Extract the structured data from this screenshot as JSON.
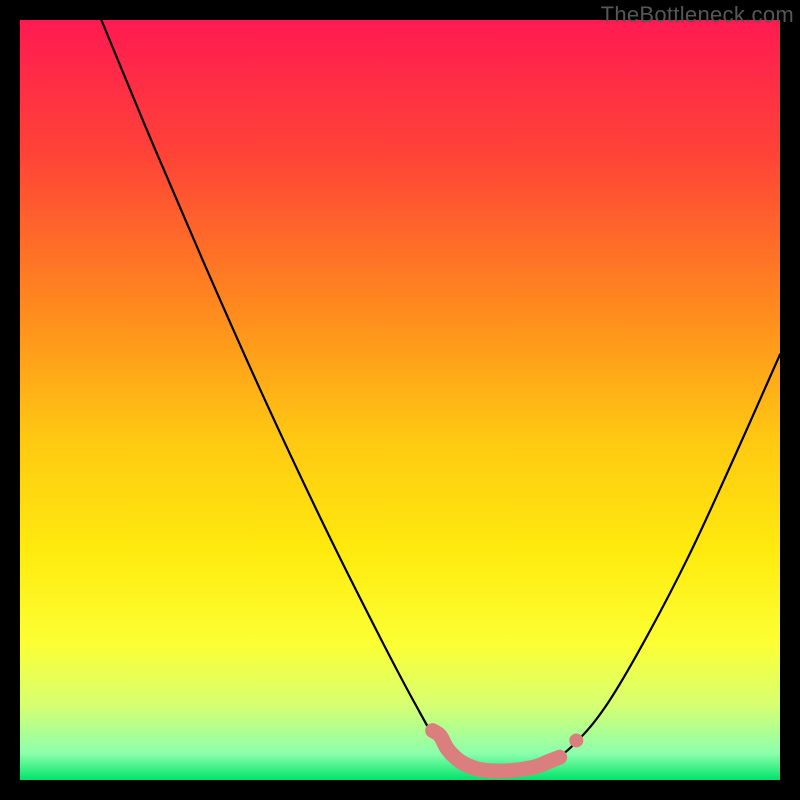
{
  "watermark": "TheBottleneck.com",
  "chart_data": {
    "type": "line",
    "title": "",
    "xlabel": "",
    "ylabel": "",
    "xlim": [
      0,
      100
    ],
    "ylim": [
      0,
      100
    ],
    "grid": false,
    "legend": null,
    "gradient_stops": [
      {
        "offset": 0.0,
        "color": "#ff1a51"
      },
      {
        "offset": 0.18,
        "color": "#ff4437"
      },
      {
        "offset": 0.38,
        "color": "#ff8a1e"
      },
      {
        "offset": 0.55,
        "color": "#ffc812"
      },
      {
        "offset": 0.7,
        "color": "#ffeb0e"
      },
      {
        "offset": 0.82,
        "color": "#fcff34"
      },
      {
        "offset": 0.9,
        "color": "#d8ff70"
      },
      {
        "offset": 0.965,
        "color": "#8cffad"
      },
      {
        "offset": 1.0,
        "color": "#00e46a"
      }
    ],
    "series": [
      {
        "name": "curve",
        "stroke": "#000000",
        "points": [
          {
            "x": 10.7,
            "y": 100.0
          },
          {
            "x": 16.5,
            "y": 86.0
          },
          {
            "x": 24.0,
            "y": 68.5
          },
          {
            "x": 32.0,
            "y": 50.5
          },
          {
            "x": 40.0,
            "y": 33.5
          },
          {
            "x": 47.0,
            "y": 19.5
          },
          {
            "x": 52.0,
            "y": 10.0
          },
          {
            "x": 55.0,
            "y": 5.0
          },
          {
            "x": 58.0,
            "y": 2.2
          },
          {
            "x": 62.0,
            "y": 1.2
          },
          {
            "x": 66.0,
            "y": 1.4
          },
          {
            "x": 70.0,
            "y": 2.6
          },
          {
            "x": 73.0,
            "y": 4.8
          },
          {
            "x": 77.0,
            "y": 9.6
          },
          {
            "x": 82.0,
            "y": 18.0
          },
          {
            "x": 88.0,
            "y": 29.5
          },
          {
            "x": 94.0,
            "y": 42.5
          },
          {
            "x": 100.0,
            "y": 56.0
          }
        ]
      },
      {
        "name": "marker-band",
        "stroke": "#da7e7e",
        "points": [
          {
            "x": 54.3,
            "y": 6.5
          },
          {
            "x": 55.3,
            "y": 5.8
          },
          {
            "x": 56.3,
            "y": 4.0
          },
          {
            "x": 58.0,
            "y": 2.4
          },
          {
            "x": 60.0,
            "y": 1.5
          },
          {
            "x": 62.0,
            "y": 1.2
          },
          {
            "x": 64.0,
            "y": 1.2
          },
          {
            "x": 66.0,
            "y": 1.4
          },
          {
            "x": 68.0,
            "y": 1.8
          },
          {
            "x": 69.5,
            "y": 2.4
          },
          {
            "x": 71.0,
            "y": 3.0
          }
        ]
      },
      {
        "name": "marker-dot",
        "type": "scatter",
        "stroke": "#da7e7e",
        "points": [
          {
            "x": 73.2,
            "y": 5.2
          }
        ]
      }
    ]
  }
}
